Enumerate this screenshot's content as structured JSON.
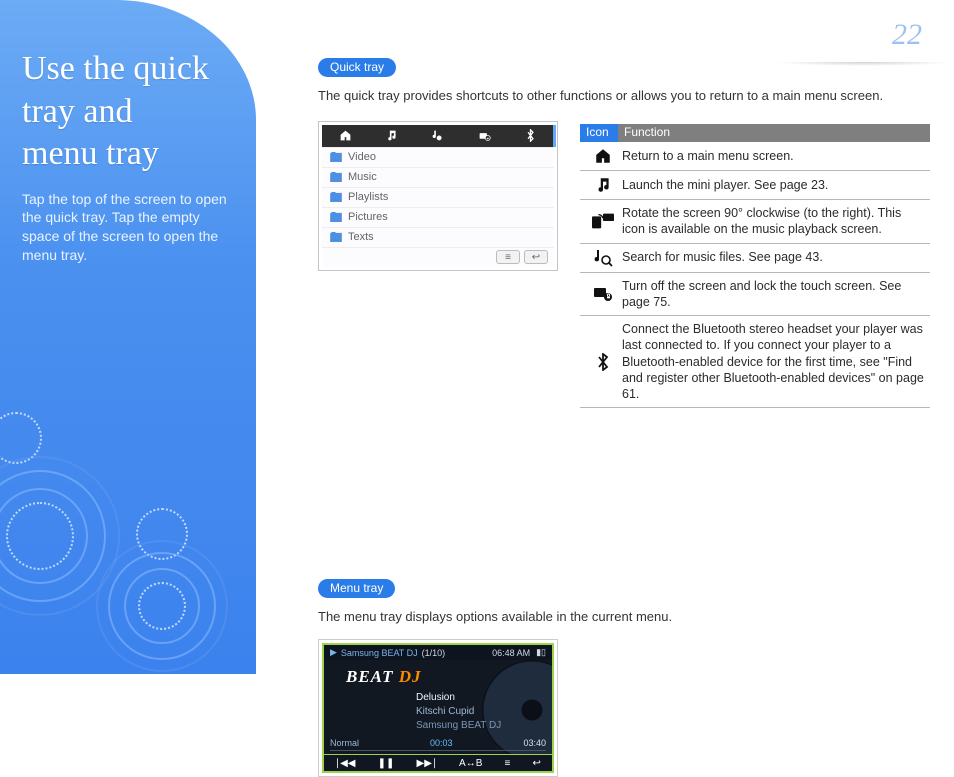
{
  "page_number": "22",
  "sidebar": {
    "title_lines": [
      "Use the quick",
      "tray and",
      "menu tray"
    ],
    "subtitle": "Tap the top of the screen to open the quick tray. Tap the empty space of the screen to open the menu tray."
  },
  "section_quick": {
    "pill": "Quick tray",
    "lead": "The quick tray provides shortcuts to other functions or allows you to return to a main menu screen.",
    "topbar_icons": [
      "home-icon",
      "music-icon",
      "note-search-icon",
      "lock-icon",
      "bluetooth-icon"
    ],
    "rows": [
      "Video",
      "Music",
      "Playlists",
      "Pictures",
      "Texts"
    ],
    "footer_buttons": [
      "menu-icon",
      "back-icon"
    ]
  },
  "table": {
    "hdr_icon": "Icon",
    "hdr_func": "Function",
    "rows": [
      {
        "icon": "home-icon",
        "text": "Return to a main menu screen."
      },
      {
        "icon": "music-icon",
        "text": "Launch the mini player. See page 23."
      },
      {
        "icon": "rotate-icon",
        "text": "Rotate the screen 90° clockwise (to the right). This icon is available on the music playback screen."
      },
      {
        "icon": "note-search-icon",
        "text": "Search for music files. See page 43."
      },
      {
        "icon": "lock-icon",
        "text": "Turn off the screen and lock the touch screen. See page 75."
      },
      {
        "icon": "bluetooth-icon",
        "text": "Connect the Bluetooth stereo headset your player was last connected to. If you connect your player to a Bluetooth-enabled device for the first time, see \"Find and register other Bluetooth-enabled devices\" on page 61."
      }
    ]
  },
  "section_menu": {
    "pill": "Menu tray",
    "lead": "The menu tray displays options available in the current menu.",
    "top_left": "Samsung BEAT DJ",
    "top_count": "(1/10)",
    "top_time": "06:48 AM",
    "title_white": "BEAT",
    "title_orange": " DJ",
    "tracks": [
      "Delusion",
      "Kitschi Cupid",
      "Samsung BEAT DJ"
    ],
    "info_left": "Normal",
    "info_mid": "00:03",
    "info_right": "03:40",
    "controls": [
      "prev-icon",
      "pause-icon",
      "next-icon",
      "ab-repeat-icon",
      "menu-icon",
      "back-icon"
    ],
    "ab_label": "A↔B"
  }
}
